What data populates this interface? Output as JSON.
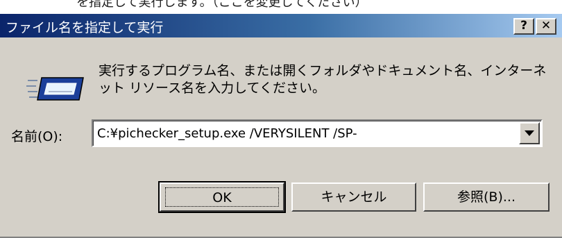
{
  "background_window": {
    "partial_text": "を指定して実行します。（ここを変更してください）"
  },
  "dialog": {
    "title": "ファイル名を指定して実行",
    "help_button_label": "?",
    "close_button_label": "✕",
    "icon": "run-icon",
    "description": "実行するプログラム名、または開くフォルダやドキュメント名、インターネット リソース名を入力してください。",
    "name_label": "名前(O):",
    "command_value": "C:¥pichecker_setup.exe /VERYSILENT /SP-",
    "buttons": {
      "ok": "OK",
      "cancel": "キャンセル",
      "browse": "参照(B)..."
    }
  },
  "colors": {
    "titlebar_start": "#0a246a",
    "titlebar_end": "#a6caf0",
    "face": "#d4d0c8"
  }
}
